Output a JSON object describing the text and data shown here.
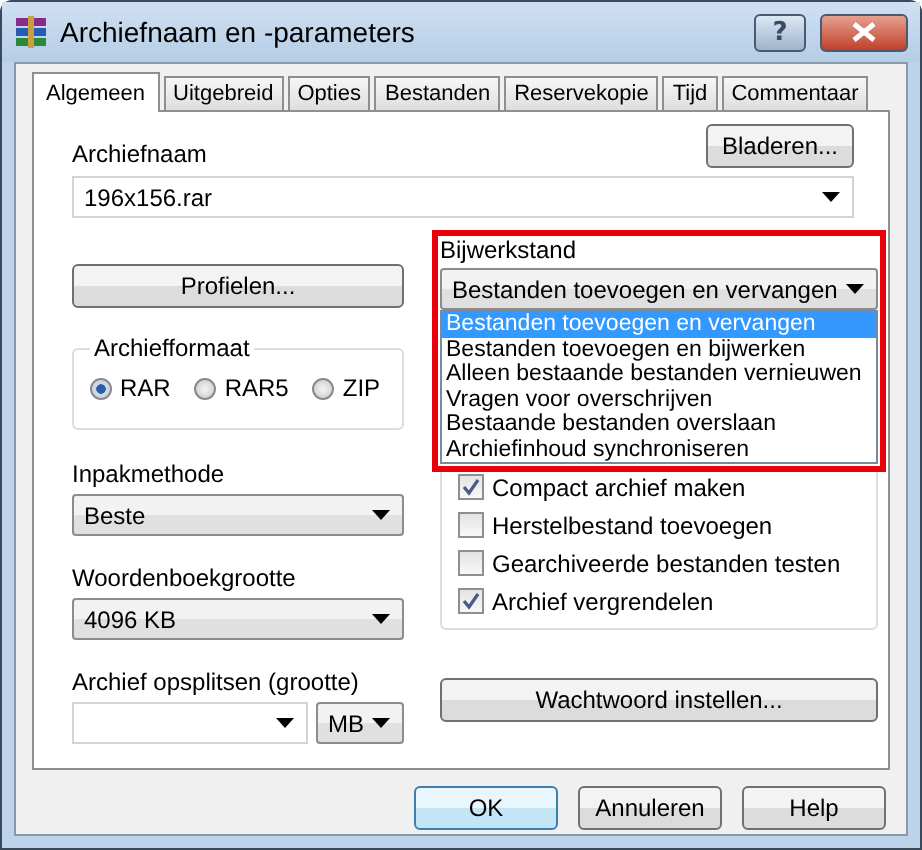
{
  "window": {
    "title": "Archiefnaam en -parameters",
    "help": "?"
  },
  "tabs": [
    {
      "label": "Algemeen",
      "selected": true
    },
    {
      "label": "Uitgebreid",
      "selected": false
    },
    {
      "label": "Opties",
      "selected": false
    },
    {
      "label": "Bestanden",
      "selected": false
    },
    {
      "label": "Reservekopie",
      "selected": false
    },
    {
      "label": "Tijd",
      "selected": false
    },
    {
      "label": "Commentaar",
      "selected": false
    }
  ],
  "archive_name": {
    "label": "Archiefnaam",
    "value": "196x156.rar",
    "browse": "Bladeren..."
  },
  "profiles": "Profielen...",
  "archive_format": {
    "title": "Archiefformaat",
    "options": [
      {
        "label": "RAR",
        "selected": true
      },
      {
        "label": "RAR5",
        "selected": false
      },
      {
        "label": "ZIP",
        "selected": false
      }
    ]
  },
  "compression_method": {
    "label": "Inpakmethode",
    "value": "Beste"
  },
  "dictionary_size": {
    "label": "Woordenboekgrootte",
    "value": "4096 KB"
  },
  "split": {
    "label": "Archief opsplitsen (grootte)",
    "unit": "MB"
  },
  "password": "Wachtwoord instellen...",
  "update_mode": {
    "label": "Bijwerkstand",
    "value": "Bestanden toevoegen en vervangen",
    "options": [
      {
        "label": "Bestanden toevoegen en vervangen",
        "selected": true
      },
      {
        "label": "Bestanden toevoegen en bijwerken",
        "selected": false
      },
      {
        "label": "Alleen bestaande bestanden vernieuwen",
        "selected": false
      },
      {
        "label": "Vragen voor overschrijven",
        "selected": false
      },
      {
        "label": "Bestaande bestanden overslaan",
        "selected": false
      },
      {
        "label": "Archiefinhoud synchroniseren",
        "selected": false
      }
    ]
  },
  "archive_options": [
    {
      "label": "Compact archief maken",
      "checked": true
    },
    {
      "label": "Herstelbestand toevoegen",
      "checked": false
    },
    {
      "label": "Gearchiveerde bestanden testen",
      "checked": false
    },
    {
      "label": "Archief vergrendelen",
      "checked": true
    }
  ],
  "buttons": [
    {
      "label": "OK",
      "default": true
    },
    {
      "label": "Annuleren",
      "default": false
    },
    {
      "label": "Help",
      "default": false
    }
  ]
}
